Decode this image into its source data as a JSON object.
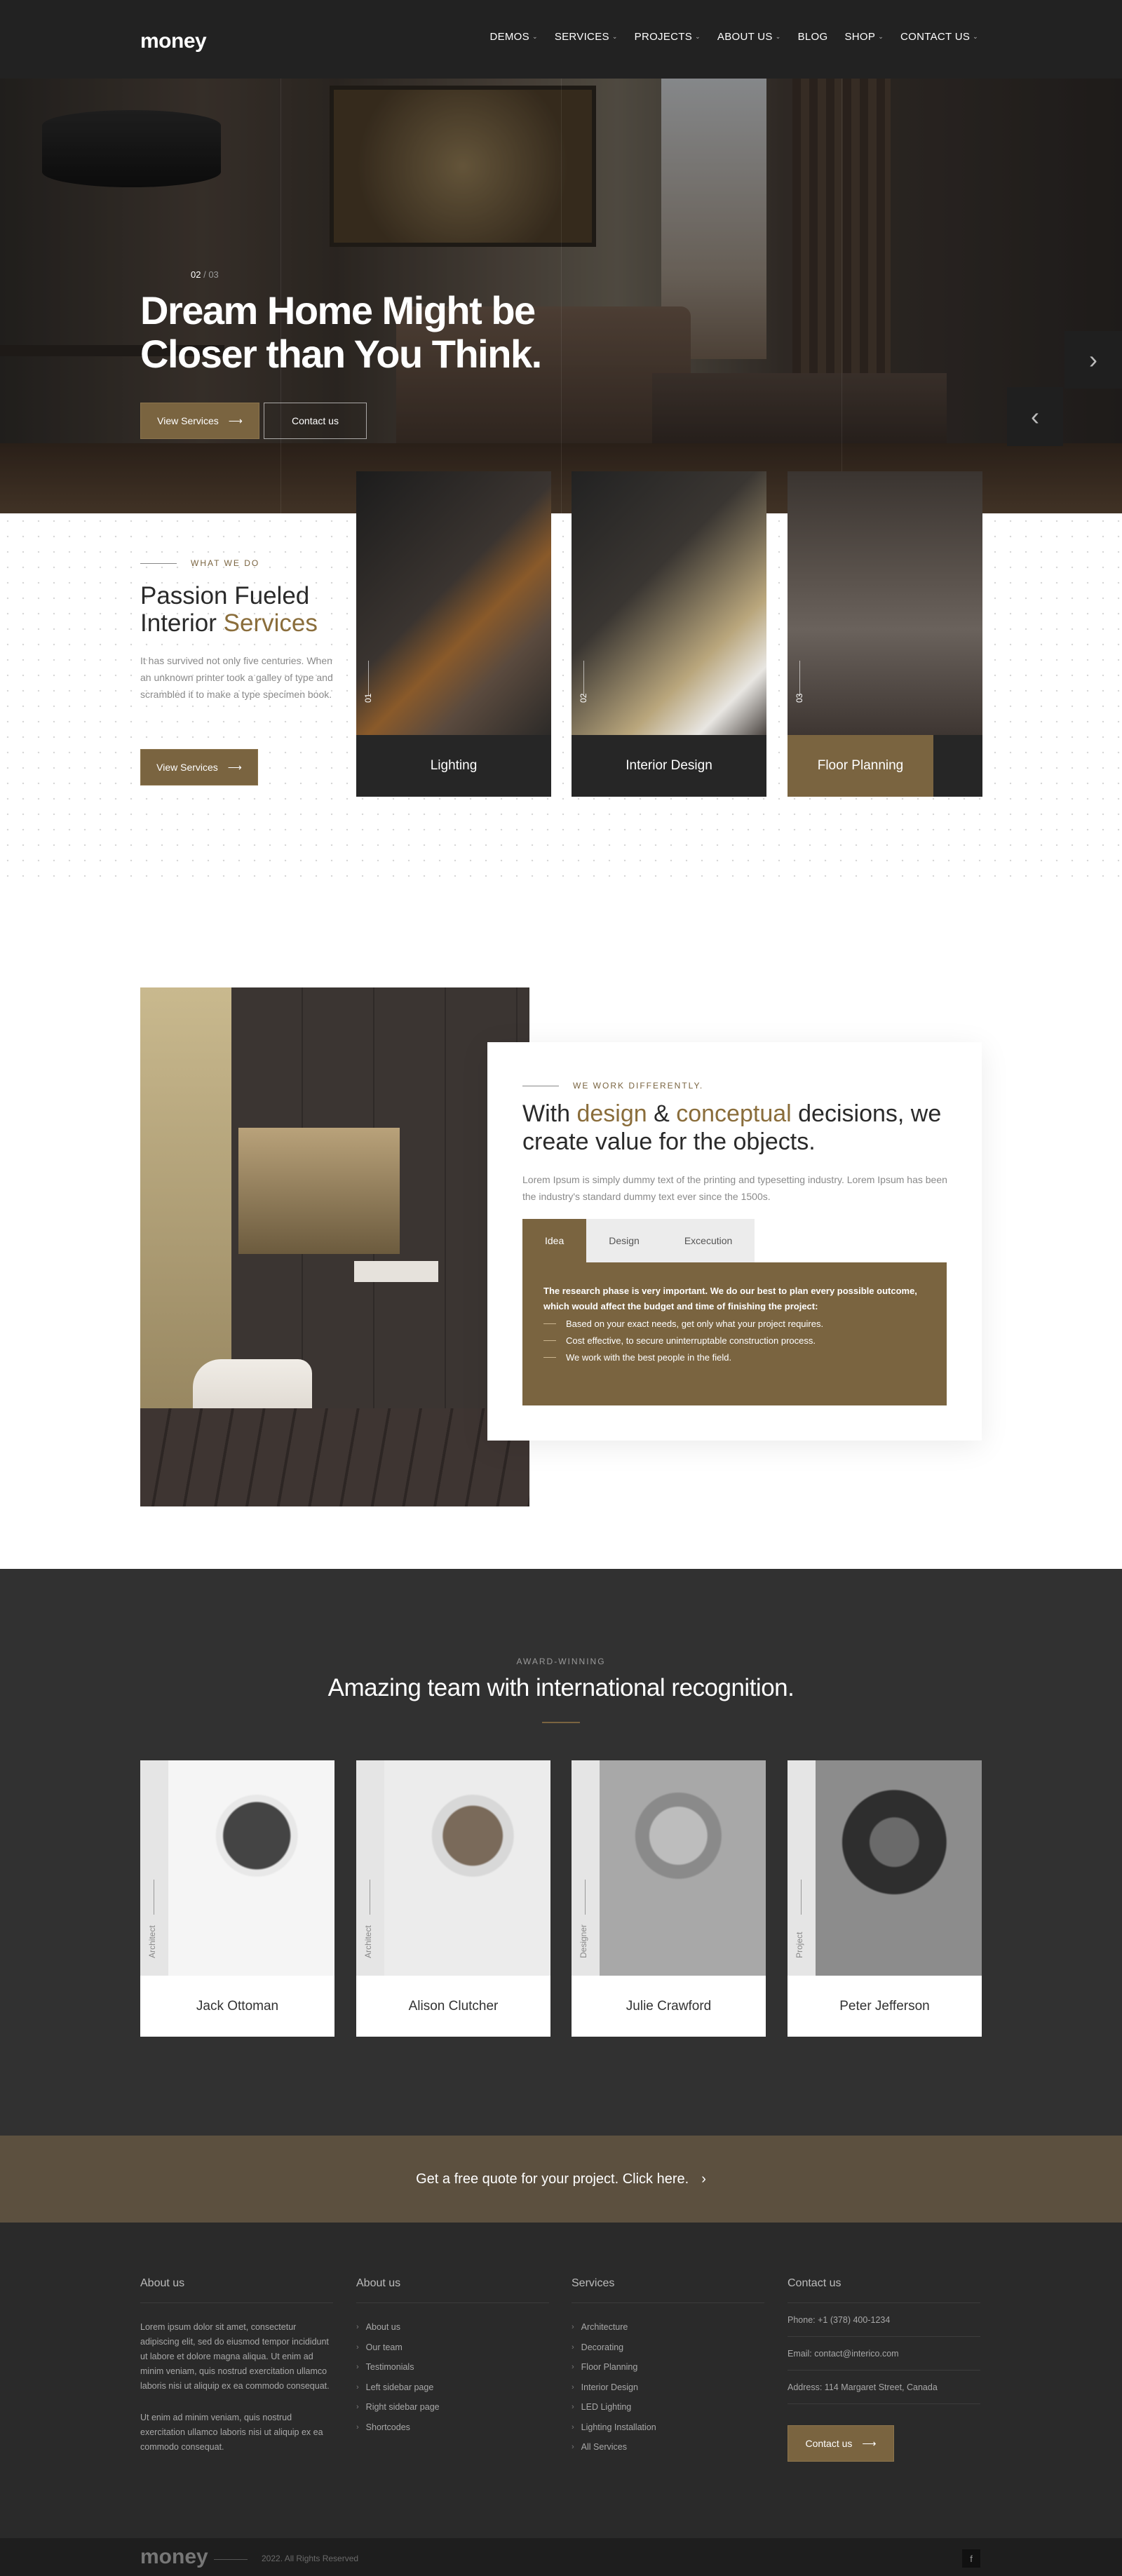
{
  "header": {
    "logo": "money",
    "nav": [
      {
        "label": "DEMOS",
        "dropdown": true
      },
      {
        "label": "SERVICES",
        "dropdown": true
      },
      {
        "label": "PROJECTS",
        "dropdown": true
      },
      {
        "label": "ABOUT US",
        "dropdown": true
      },
      {
        "label": "BLOG",
        "dropdown": false
      },
      {
        "label": "SHOP",
        "dropdown": true
      },
      {
        "label": "CONTACT US",
        "dropdown": true
      }
    ]
  },
  "hero": {
    "slide_current": "02",
    "slide_total": "/ 03",
    "title": "Dream Home Might be Closer than You Think.",
    "primary_button": "View Services",
    "secondary_button": "Contact us",
    "prev_icon": "chevron-left-icon",
    "next_icon": "chevron-right-icon"
  },
  "what_we_do": {
    "label": "WHAT WE DO",
    "title_start": "Passion Fueled Interior ",
    "title_highlight": "Services",
    "description": "It has survived not only five centuries. When an unknown printer took a galley of type and scrambled it to make a type specimen book.",
    "button": "View Services",
    "cards": [
      {
        "number": "01",
        "caption": "Lighting"
      },
      {
        "number": "02",
        "caption": "Interior Design"
      },
      {
        "number": "03",
        "caption": "Floor Planning"
      }
    ]
  },
  "design": {
    "label": "WE WORK DIFFERENTLY.",
    "title": [
      "With ",
      "design",
      " & ",
      "conceptual",
      " decisions, we create value for the objects."
    ],
    "description": "Lorem Ipsum is simply dummy text of the printing and typesetting industry. Lorem Ipsum has been the industry's standard dummy text ever since the 1500s.",
    "tabs": [
      "Idea",
      "Design",
      "Excecution"
    ],
    "active_tab": "Idea",
    "panel_text": "The research phase is very important. We do our best to plan every possible outcome, which would affect the budget and time of finishing the project:",
    "panel_items": [
      "Based on your exact needs, get only what your project requires.",
      "Cost effective, to secure uninterruptable construction process.",
      "We work with the best people in the field."
    ]
  },
  "team": {
    "label": "AWARD-WINNING",
    "title": "Amazing team with international recognition.",
    "members": [
      {
        "role": "Architect",
        "name": "Jack Ottoman"
      },
      {
        "role": "Architect",
        "name": "Alison Clutcher"
      },
      {
        "role": "Designer",
        "name": "Julie Crawford"
      },
      {
        "role": "Project",
        "name": "Peter Jefferson"
      }
    ]
  },
  "quote_banner": {
    "text": "Get a free quote for your project. Click here.",
    "icon": "chevron-right-icon"
  },
  "footer": {
    "about": {
      "heading": "About us",
      "p1": "Lorem ipsum dolor sit amet, consectetur adipiscing elit, sed do eiusmod tempor incididunt ut labore et dolore magna aliqua. Ut enim ad minim veniam, quis nostrud exercitation ullamco laboris nisi ut aliquip ex ea commodo consequat.",
      "p2": "Ut enim ad minim veniam, quis nostrud exercitation ullamco laboris nisi ut aliquip ex ea commodo consequat."
    },
    "links": {
      "heading": "About us",
      "items": [
        "About us",
        "Our team",
        "Testimonials",
        "Left sidebar page",
        "Right sidebar page",
        "Shortcodes"
      ]
    },
    "services": {
      "heading": "Services",
      "items": [
        "Architecture",
        "Decorating",
        "Floor Planning",
        "Interior Design",
        "LED Lighting",
        "Lighting Installation",
        "All Services"
      ]
    },
    "contact": {
      "heading": "Contact us",
      "phone": "Phone: +1 (378) 400-1234",
      "email": "Email: contact@interico.com",
      "address": "Address: 114 Margaret Street, Canada",
      "button": "Contact us"
    }
  },
  "bottom_bar": {
    "logo": "money",
    "copyright": "2022. All Rights Reserved",
    "social_icon": "facebook-icon",
    "social_label": "f"
  },
  "colors": {
    "accent": "#7a6440",
    "dark": "#222222",
    "team_bg": "#313131",
    "footer_bg": "#2a2a2a"
  }
}
